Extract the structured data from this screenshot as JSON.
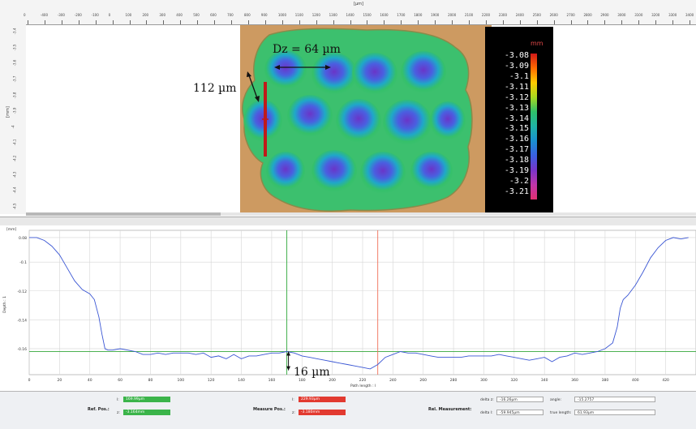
{
  "top_ruler": {
    "unit": "[µm]",
    "ticks": [
      "0",
      "-400",
      "-300",
      "-200",
      "-100",
      "0",
      "100",
      "200",
      "300",
      "400",
      "500",
      "600",
      "700",
      "800",
      "900",
      "1000",
      "1100",
      "1200",
      "1300",
      "1400",
      "1500",
      "1600",
      "1700",
      "1800",
      "1900",
      "2000",
      "2100",
      "2200",
      "2300",
      "2400",
      "2500",
      "2600",
      "2700",
      "2800",
      "2900",
      "3000",
      "3100",
      "3200",
      "3300",
      "3400"
    ]
  },
  "left_ruler": {
    "unit": "[mm]",
    "ticks": [
      "-3.4",
      "-3.5",
      "-3.6",
      "-3.7",
      "-3.8",
      "-3.9",
      "-4",
      "-4.1",
      "-4.2",
      "-4.3",
      "-4.4",
      "-4.5"
    ]
  },
  "annotations": {
    "dz_label": "Dz = 64 µm",
    "width_label": "112 µm",
    "depth_label": "16 µm"
  },
  "colorbar": {
    "unit": "mm",
    "labels": [
      "-3.08",
      "-3.09",
      "-3.1",
      "-3.11",
      "-3.12",
      "-3.13",
      "-3.14",
      "-3.15",
      "-3.16",
      "-3.17",
      "-3.18",
      "-3.19",
      "-3.2",
      "-3.21"
    ],
    "colors": [
      "#d01818",
      "#ff6a00",
      "#ffcc00",
      "#d6e000",
      "#7cd23a",
      "#2ec06a",
      "#1fb2a6",
      "#1a8fd2",
      "#3a5fe0",
      "#5a3ad0",
      "#8a35c8",
      "#b135b0",
      "#d335a0",
      "#e03080"
    ]
  },
  "graph": {
    "unit": "[mm]",
    "y_axis_label": "Depth : 1",
    "x_axis_label": "Path length : l",
    "y_ticks": [
      "0.08",
      "-0.1",
      "-0.12",
      "-0.14",
      "-0.16"
    ],
    "x_ticks": [
      "0",
      "20",
      "40",
      "60",
      "80",
      "100",
      "120",
      "140",
      "160",
      "180",
      "200",
      "220",
      "240",
      "260",
      "280",
      "300",
      "320",
      "340",
      "360",
      "380",
      "400",
      "420"
    ]
  },
  "profile_data": {
    "type": "line",
    "x": [
      0,
      5,
      10,
      15,
      20,
      25,
      30,
      35,
      40,
      43,
      46,
      48,
      50,
      52,
      55,
      60,
      65,
      70,
      75,
      80,
      85,
      90,
      95,
      100,
      105,
      110,
      115,
      120,
      125,
      130,
      135,
      140,
      145,
      150,
      155,
      160,
      165,
      170,
      175,
      180,
      185,
      190,
      195,
      200,
      205,
      210,
      215,
      220,
      225,
      230,
      235,
      240,
      245,
      250,
      255,
      260,
      265,
      270,
      275,
      280,
      285,
      290,
      295,
      300,
      305,
      310,
      315,
      320,
      325,
      330,
      335,
      340,
      345,
      350,
      355,
      360,
      365,
      370,
      375,
      380,
      385,
      388,
      390,
      392,
      395,
      400,
      405,
      410,
      415,
      420,
      425,
      430,
      435
    ],
    "y": [
      -0.083,
      -0.083,
      -0.085,
      -0.089,
      -0.095,
      -0.104,
      -0.113,
      -0.119,
      -0.122,
      -0.126,
      -0.138,
      -0.15,
      -0.16,
      -0.161,
      -0.161,
      -0.16,
      -0.161,
      -0.162,
      -0.164,
      -0.164,
      -0.163,
      -0.164,
      -0.163,
      -0.163,
      -0.163,
      -0.164,
      -0.163,
      -0.166,
      -0.165,
      -0.167,
      -0.164,
      -0.167,
      -0.165,
      -0.165,
      -0.164,
      -0.163,
      -0.163,
      -0.162,
      -0.163,
      -0.165,
      -0.166,
      -0.167,
      -0.168,
      -0.169,
      -0.17,
      -0.171,
      -0.172,
      -0.173,
      -0.174,
      -0.171,
      -0.166,
      -0.164,
      -0.162,
      -0.163,
      -0.163,
      -0.164,
      -0.165,
      -0.166,
      -0.166,
      -0.166,
      -0.166,
      -0.165,
      -0.165,
      -0.165,
      -0.165,
      -0.164,
      -0.165,
      -0.166,
      -0.167,
      -0.168,
      -0.167,
      -0.166,
      -0.169,
      -0.166,
      -0.165,
      -0.163,
      -0.164,
      -0.163,
      -0.162,
      -0.16,
      -0.156,
      -0.145,
      -0.132,
      -0.126,
      -0.123,
      -0.116,
      -0.107,
      -0.097,
      -0.09,
      -0.085,
      -0.083,
      -0.084,
      -0.083
    ],
    "reference_x": 170,
    "measure_x": 230,
    "baseline_y": -0.162,
    "xlim": [
      0,
      440
    ],
    "ylim": [
      -0.178,
      -0.078
    ],
    "colors": {
      "profile": "#3a56d4",
      "reference": "#2fa83a",
      "measure": "#f0705a",
      "baseline": "#32a63a"
    }
  },
  "bottom": {
    "ref_pos_label": "Ref. Pos.:",
    "ref_x_key": "l:",
    "ref_x": "169.99µm",
    "ref_y_key": "z:",
    "ref_y": "-3.164mm",
    "measure_pos_label": "Measure Pos.:",
    "measure_x_key": "l:",
    "measure_x": "229.93µm",
    "measure_y_key": "z:",
    "measure_y": "-3.180mm",
    "ref_measurement_label": "Rel. Measurement:",
    "delta_y_key": "delta z:",
    "delta_y": "-16.26µm",
    "delta_x_key": "delta l:",
    "delta_x": "-59.945µm",
    "angle_key": "angle:",
    "angle": "-15.2757",
    "length_key": "true length:",
    "length": "61.93µm"
  }
}
